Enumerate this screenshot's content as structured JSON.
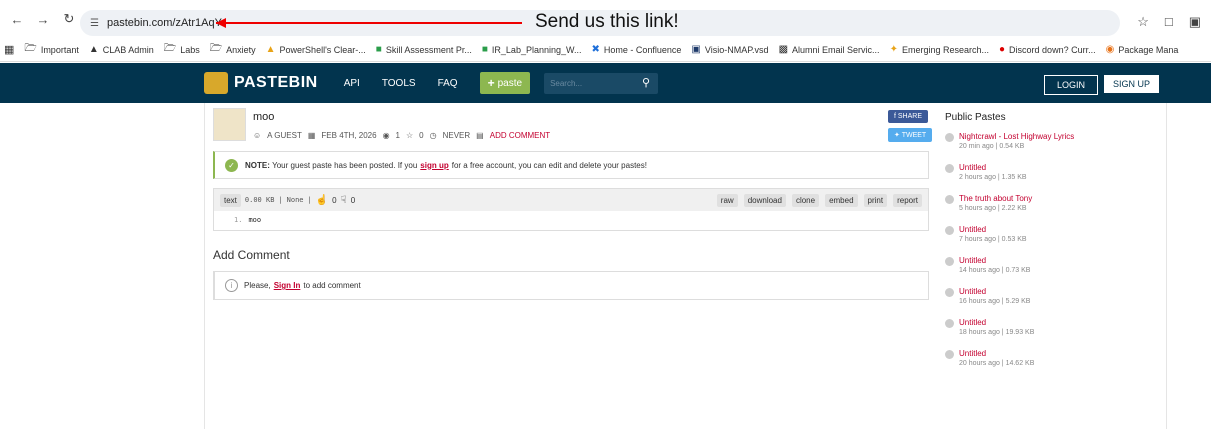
{
  "browser": {
    "url": "pastebin.com/zAtr1AqY",
    "annotation": "Send us this link!"
  },
  "bookmarks": [
    {
      "label": "Important",
      "icon": "folder-icon"
    },
    {
      "label": "CLAB Admin",
      "icon": "circle-icon"
    },
    {
      "label": "Labs",
      "icon": "folder-icon"
    },
    {
      "label": "Anxiety",
      "icon": "folder-icon"
    },
    {
      "label": "PowerShell's Clear-...",
      "icon": "site-icon"
    },
    {
      "label": "Skill Assessment Pr...",
      "icon": "site-icon"
    },
    {
      "label": "IR_Lab_Planning_W...",
      "icon": "site-icon"
    },
    {
      "label": "Home - Confluence",
      "icon": "site-icon"
    },
    {
      "label": "Visio-NMAP.vsd",
      "icon": "site-icon"
    },
    {
      "label": "Alumni Email Servic...",
      "icon": "site-icon"
    },
    {
      "label": "Emerging Research...",
      "icon": "site-icon"
    },
    {
      "label": "Discord down? Curr...",
      "icon": "site-icon"
    },
    {
      "label": "Package Mana",
      "icon": "site-icon"
    }
  ],
  "header": {
    "logo": "PASTEBIN",
    "nav": [
      "API",
      "TOOLS",
      "FAQ"
    ],
    "paste_button": "paste",
    "search_placeholder": "Search...",
    "login": "LOGIN",
    "signup": "SIGN UP"
  },
  "paste": {
    "title": "moo",
    "author": "A GUEST",
    "date": "FEB 4TH, 2026",
    "views": "1",
    "stars": "0",
    "expiry": "NEVER",
    "add_comment": "ADD COMMENT",
    "share": "SHARE",
    "tweet": "TWEET"
  },
  "notice": {
    "bold": "NOTE:",
    "text1": "Your guest paste has been posted. If you",
    "link": "sign up",
    "text2": "for a free account, you can edit and delete your pastes!"
  },
  "code": {
    "syntax": "text",
    "size": "0.00 KB",
    "category": "None",
    "likes": "0",
    "dislikes": "0",
    "actions": [
      "raw",
      "download",
      "clone",
      "embed",
      "print",
      "report"
    ],
    "line_number": "1.",
    "line": "moo"
  },
  "comments": {
    "heading": "Add Comment",
    "text1": "Please,",
    "link": "Sign In",
    "text2": "to add comment"
  },
  "sidebar": {
    "title": "Public Pastes",
    "items": [
      {
        "name": "Nightcrawl - Lost Highway Lyrics",
        "meta": "20 min ago | 0.54 KB"
      },
      {
        "name": "Untitled",
        "meta": "2 hours ago | 1.35 KB"
      },
      {
        "name": "The truth about Tony",
        "meta": "5 hours ago | 2.22 KB"
      },
      {
        "name": "Untitled",
        "meta": "7 hours ago | 0.53 KB"
      },
      {
        "name": "Untitled",
        "meta": "14 hours ago | 0.73 KB"
      },
      {
        "name": "Untitled",
        "meta": "16 hours ago | 5.29 KB"
      },
      {
        "name": "Untitled",
        "meta": "18 hours ago | 19.93 KB"
      },
      {
        "name": "Untitled",
        "meta": "20 hours ago | 14.62 KB"
      }
    ]
  }
}
